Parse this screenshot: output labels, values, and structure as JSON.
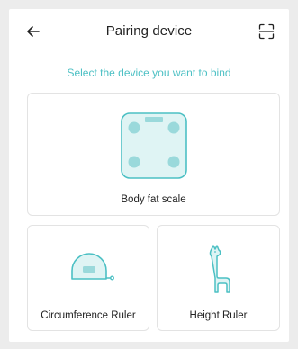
{
  "header": {
    "title": "Pairing device",
    "back_icon": "arrow-left-icon",
    "scan_icon": "scan-frame-icon"
  },
  "subtitle": "Select the device you want to bind",
  "devices": [
    {
      "label": "Body fat scale",
      "icon": "body-fat-scale-icon"
    },
    {
      "label": "Circumference Ruler",
      "icon": "tape-measure-icon"
    },
    {
      "label": "Height Ruler",
      "icon": "giraffe-height-icon"
    }
  ],
  "colors": {
    "accent": "#4cc0c4",
    "icon_fill": "#dff4f4",
    "text": "#222222",
    "card_border": "#e3e3e3",
    "background": "#ececec"
  }
}
